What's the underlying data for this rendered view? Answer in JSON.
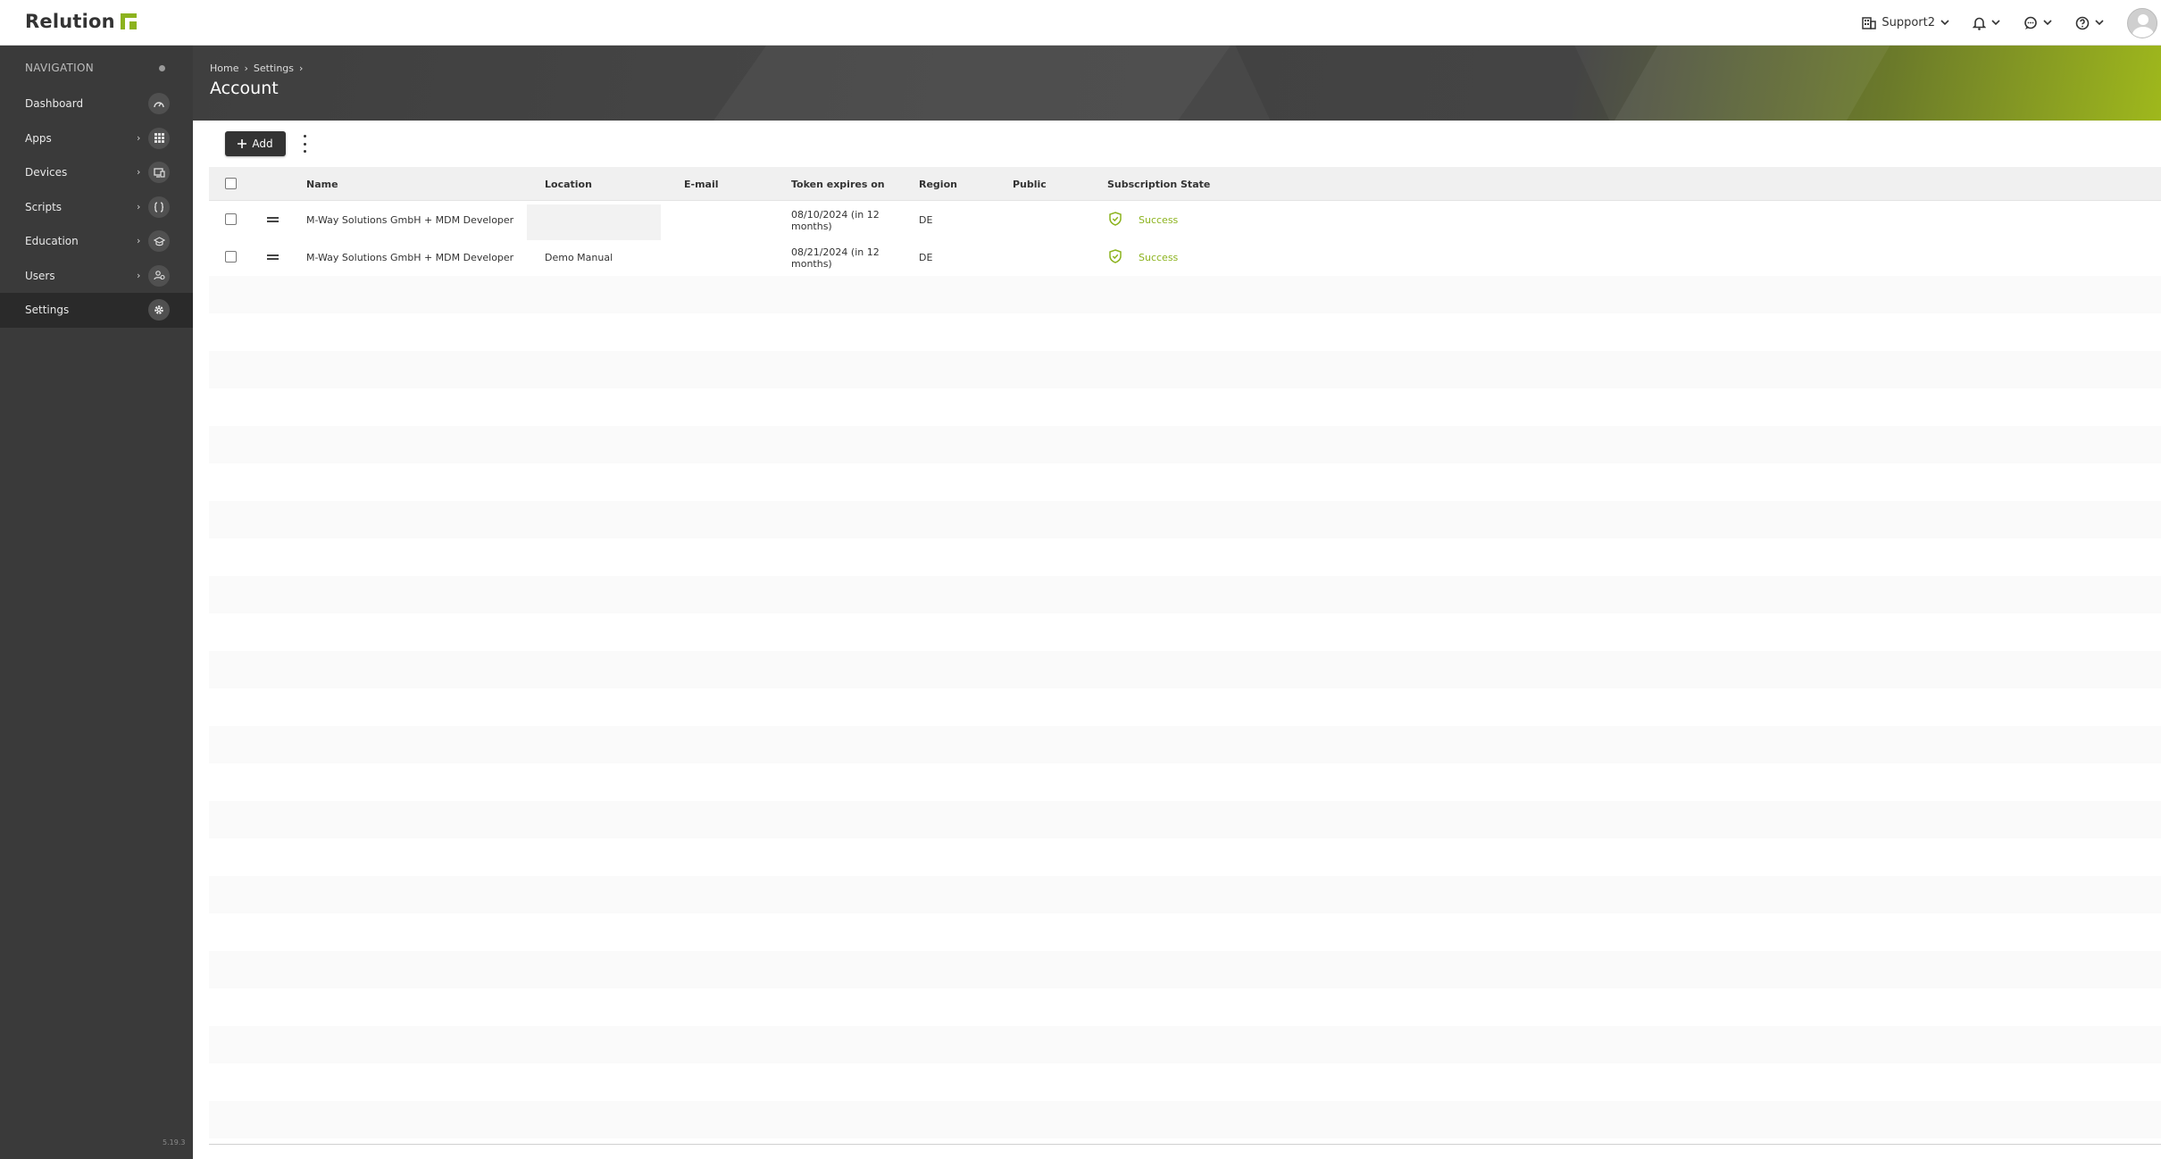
{
  "header": {
    "brand": "Relution",
    "org_label": "Support2",
    "colors": {
      "accent": "#8cb31e",
      "sidebar": "#3a3a3a"
    }
  },
  "sidebar": {
    "title": "NAVIGATION",
    "items": [
      {
        "label": "Dashboard",
        "icon": "dashboard-icon",
        "has_submenu": false
      },
      {
        "label": "Apps",
        "icon": "grid-icon",
        "has_submenu": true
      },
      {
        "label": "Devices",
        "icon": "devices-icon",
        "has_submenu": true
      },
      {
        "label": "Scripts",
        "icon": "braces-icon",
        "has_submenu": true
      },
      {
        "label": "Education",
        "icon": "graduation-cap-icon",
        "has_submenu": true
      },
      {
        "label": "Users",
        "icon": "users-icon",
        "has_submenu": true
      },
      {
        "label": "Settings",
        "icon": "gear-icon",
        "has_submenu": false,
        "active": true
      }
    ],
    "version": "5.19.3"
  },
  "banner": {
    "breadcrumbs": [
      "Home",
      "Settings"
    ],
    "title": "Account"
  },
  "toolbar": {
    "add_label": "Add"
  },
  "table": {
    "columns": [
      "Name",
      "Location",
      "E-mail",
      "Token expires on",
      "Region",
      "Public",
      "Subscription State"
    ],
    "rows": [
      {
        "name": "M-Way Solutions GmbH + MDM Developer",
        "location": "",
        "email": "",
        "token_date": "08/10/2024 (in 12",
        "token_rel": "months)",
        "region": "DE",
        "public": "",
        "state": "Success"
      },
      {
        "name": "M-Way Solutions GmbH + MDM Developer",
        "location": "Demo Manual",
        "email": "",
        "token_date": "08/21/2024 (in 12",
        "token_rel": "months)",
        "region": "DE",
        "public": "",
        "state": "Success"
      }
    ]
  }
}
